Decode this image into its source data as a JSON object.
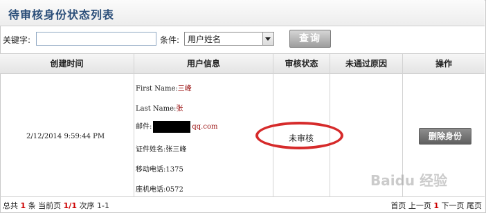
{
  "header": {
    "title": "待审核身份状态列表"
  },
  "filter": {
    "keyword_label": "关键字:",
    "keyword_value": "",
    "condition_label": "条件:",
    "condition_selected": "用户姓名",
    "query_button": "查询"
  },
  "table": {
    "columns": [
      "创建时间",
      "用户信息",
      "审核状态",
      "未通过原因",
      "操作"
    ],
    "rows": [
      {
        "created_time": "2/12/2014 9:59:44 PM",
        "first_name_label": "First Name:",
        "first_name": "三峰",
        "last_name_label": "Last Name:",
        "last_name": "张",
        "email_label": "邮件:",
        "email_domain": "qq.com",
        "id_name": "证件姓名:张三峰",
        "mobile": "移动电话:1375",
        "landline": "座机电话:0572",
        "status": "未审核",
        "reject_reason": "",
        "action": "删除身份"
      }
    ]
  },
  "footer": {
    "total_prefix": "总共",
    "total_count": "1",
    "total_unit": "条 当前页",
    "page": "1/1",
    "order": "次序 1-1",
    "first": "首页",
    "prev": "上一页",
    "current": "1",
    "next": "下一页",
    "last": "尾页"
  },
  "watermark": "Baidu 经验",
  "colors": {
    "title": "#2c4f7a",
    "highlight_ellipse": "#d62b2b",
    "red_text": "#9b1111"
  }
}
